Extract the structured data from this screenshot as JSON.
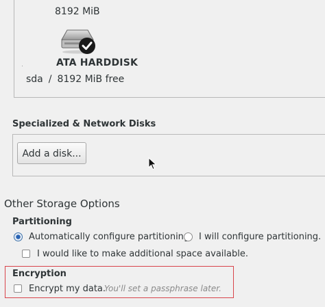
{
  "local_disk": {
    "size": "8192 MiB",
    "name": "ATA HARDDISK",
    "device": "sda",
    "separator": "/",
    "free": "8192 MiB free",
    "icon": "harddisk-icon",
    "selected": true
  },
  "specialized": {
    "title": "Specialized & Network Disks",
    "add_button": "Add a disk..."
  },
  "other_storage": {
    "title": "Other Storage Options",
    "partitioning": {
      "title": "Partitioning",
      "auto_label": "Automatically configure partitioning.",
      "manual_label": "I will configure partitioning.",
      "selected": "auto",
      "extra_space_label": "I would like to make additional space available.",
      "extra_space_checked": false
    },
    "encryption": {
      "title": "Encryption",
      "encrypt_label": "Encrypt my data.",
      "hint": "You'll set a passphrase later.",
      "checked": false
    }
  },
  "colors": {
    "highlight_border": "#d8434a",
    "accent": "#2a64b4"
  }
}
